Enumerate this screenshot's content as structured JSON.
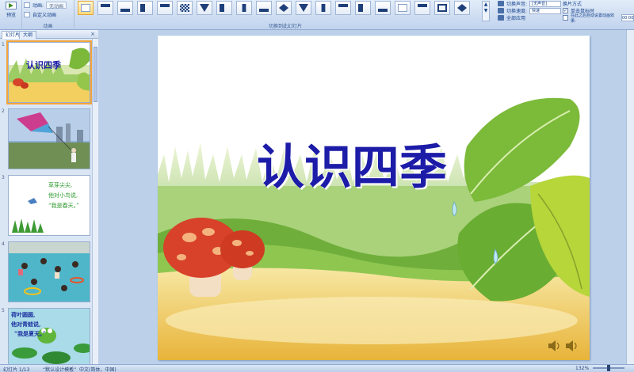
{
  "ribbon": {
    "preview_group": {
      "preview_label": "预览",
      "group_label": "预览"
    },
    "animation_group": {
      "animate_label": "动画:",
      "animate_value": "无动画",
      "custom_label": "自定义动画",
      "group_label": "动画"
    },
    "transition_group": {
      "group_label": "切换到此幻灯片"
    },
    "right_group": {
      "sound_label": "切换声音:",
      "sound_value": "[无声音]",
      "speed_label": "切换速度:",
      "speed_value": "快速",
      "apply_all_label": "全部应用",
      "advance_title": "换片方式",
      "on_click_label": "单击鼠标时",
      "auto_label": "在此之后自动设置动画效果:",
      "auto_value": "00:00"
    }
  },
  "left_pane": {
    "tabs": [
      "幻灯片",
      "大纲"
    ],
    "close": "×",
    "thumbnails": [
      {
        "number": "1",
        "title": "认识四季"
      },
      {
        "number": "2",
        "title": ""
      },
      {
        "number": "3",
        "lines": [
          "草芽尖尖,",
          "他对小鸟说,",
          "“我是春天。”"
        ]
      },
      {
        "number": "4",
        "title": ""
      },
      {
        "number": "5",
        "lines": [
          "荷叶圆圆,",
          "他对青蛙说,",
          "“我是夏天。”"
        ]
      }
    ]
  },
  "slide": {
    "title": "认识四季"
  },
  "status": {
    "slide_info": "幻灯片 1/13",
    "theme": "“默认设计模板”",
    "language": "中文(简体，中国)",
    "zoom": "132%"
  },
  "colors": {
    "title": "#1c1ca8",
    "ribbon": "#cddcf1",
    "workspace": "#bcd0ea"
  }
}
